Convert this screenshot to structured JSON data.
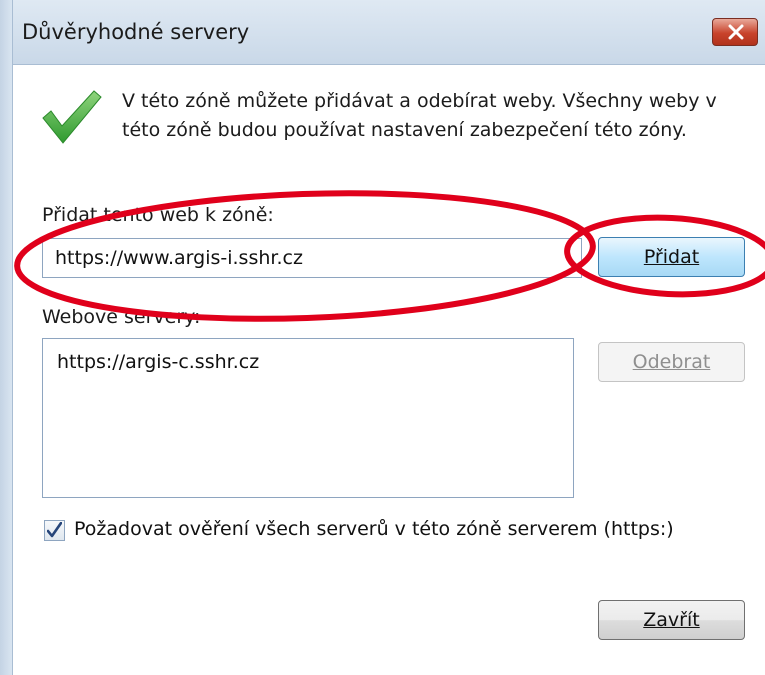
{
  "window": {
    "title": "Důvěryhodné servery"
  },
  "info": {
    "text": "V této zóně můžete přidávat a odebírat weby. Všechny weby v této zóně budou používat nastavení zabezpečení této zóny.",
    "icon": "check-icon"
  },
  "add_site": {
    "label": "Přidat tento web k zóně:",
    "url_value": "https://www.argis-i.sshr.cz",
    "add_button_label": "Přidat"
  },
  "servers": {
    "label": "Webové servery:",
    "items": [
      "https://argis-c.sshr.cz"
    ],
    "remove_button_label": "Odebrat"
  },
  "require_https": {
    "checked": true,
    "label": "Požadovat ověření všech serverů v této zóně serverem (https:)"
  },
  "footer": {
    "close_button_label": "Zavřít"
  },
  "colors": {
    "annotation": "#e0001b",
    "check_green": "#3aa63a"
  }
}
